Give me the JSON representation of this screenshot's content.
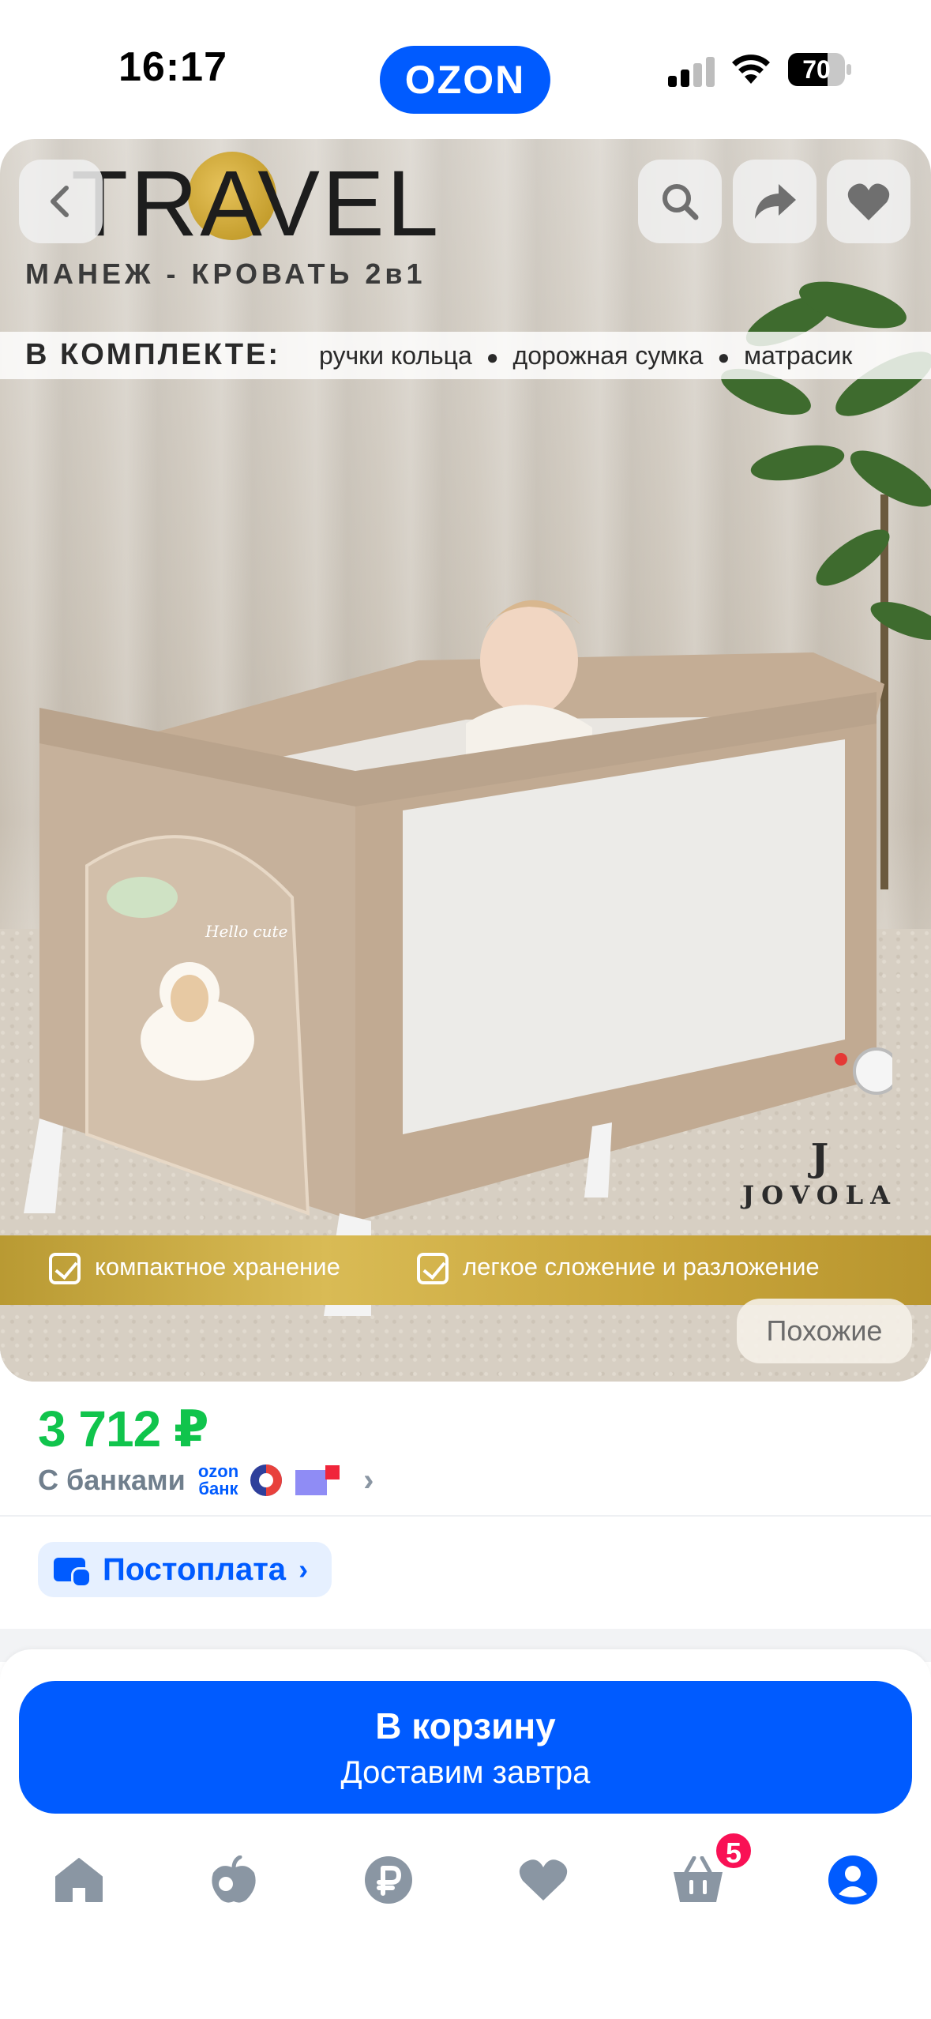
{
  "status_bar": {
    "time": "16:17",
    "app_logo": "OZON",
    "battery_level": "70",
    "battery_fraction": 0.7
  },
  "gallery": {
    "brand": "TRAVEL",
    "subtitle": "МАНЕЖ - КРОВАТЬ 2в1",
    "kit_label": "В КОМПЛЕКТЕ:",
    "kit_items": [
      "ручки кольца",
      "дорожная сумка",
      "матрасик"
    ],
    "crib_label": "Hello cute",
    "logo_word": "JOVOLA",
    "logo_mark": "J",
    "features": [
      "компактное хранение",
      "легкое сложение и разложение"
    ],
    "similar_label": "Похожие",
    "icons": {
      "back": "chevron-left-icon",
      "search": "search-icon",
      "share": "share-icon",
      "favorite": "heart-icon"
    }
  },
  "price": {
    "value": "3 712 ₽",
    "banks_label": "С банками",
    "ozon_bank_line1": "ozon",
    "ozon_bank_line2": "банк"
  },
  "postpay": {
    "label": "Постоплата"
  },
  "cart_button": {
    "title": "В корзину",
    "subtitle": "Доставим завтра"
  },
  "tabbar": {
    "items": [
      "home-icon",
      "fresh-apple-icon",
      "ruble-icon",
      "heart-icon",
      "cart-icon",
      "profile-icon"
    ],
    "cart_badge": "5",
    "active": "profile-icon"
  },
  "colors": {
    "brand_blue": "#005bff",
    "price_green": "#10c44c",
    "badge_pink": "#f91155",
    "inactive_icon": "#8a96a3"
  }
}
